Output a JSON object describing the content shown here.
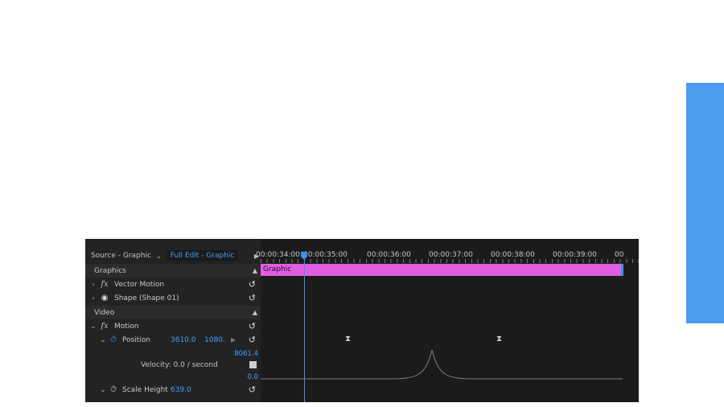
{
  "source": {
    "label": "Source - Graphic",
    "sequence": "Full Edit - Graphic"
  },
  "sections": {
    "graphics": "Graphics",
    "video": "Video"
  },
  "effects": {
    "vector_motion": "Vector Motion",
    "shape": "Shape (Shape 01)",
    "motion": "Motion"
  },
  "position": {
    "label": "Position",
    "x": "3610.0",
    "y": "1080.0"
  },
  "graph": {
    "max": "8061.4",
    "min": "0.0",
    "velocity": "Velocity: 0.0 / second"
  },
  "scale_height": {
    "label": "Scale Height",
    "value": "639.0"
  },
  "timeline": {
    "ticks": [
      "00:00:34:00",
      "00:00:35:00",
      "00:00:36:00",
      "00:00:37:00",
      "00:00:38:00",
      "00:00:39:00",
      "00"
    ],
    "clip_label": "Graphic"
  },
  "colors": {
    "accent": "#3fa0ff",
    "clip": "#e05fe0",
    "side_bar": "#4d9bf0"
  },
  "icons": [
    "fx-icon",
    "eye-icon",
    "stopwatch-icon",
    "reset-icon",
    "keyframe-icon",
    "chevron-icon",
    "play-icon"
  ]
}
